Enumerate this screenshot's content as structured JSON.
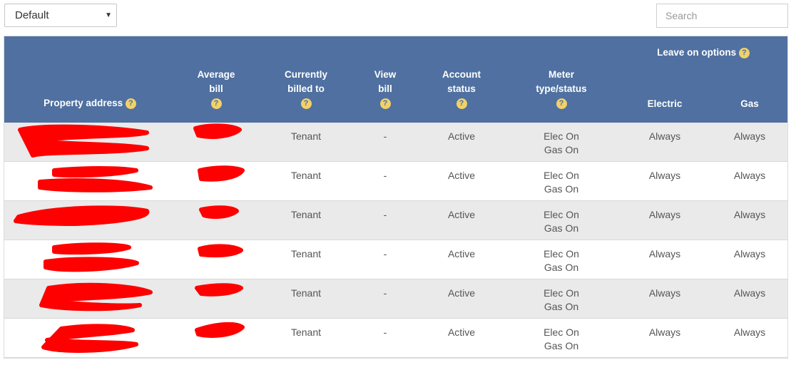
{
  "filter": {
    "selected": "Default",
    "caret": "▼"
  },
  "search": {
    "placeholder": "Search"
  },
  "header": {
    "property_address": "Property address",
    "average_bill_line1": "Average",
    "average_bill_line2": "bill",
    "currently_billed_line1": "Currently",
    "currently_billed_line2": "billed to",
    "view_bill_line1": "View",
    "view_bill_line2": "bill",
    "account_status_line1": "Account",
    "account_status_line2": "status",
    "meter_line1": "Meter",
    "meter_line2": "type/status",
    "leave_on_options": "Leave on options",
    "electric": "Electric",
    "gas": "Gas",
    "help_glyph": "?"
  },
  "rows": [
    {
      "billed_to": "Tenant",
      "view_bill": "-",
      "status": "Active",
      "meter_elec": "Elec On",
      "meter_gas": "Gas On",
      "leave_electric": "Always",
      "leave_gas": "Always"
    },
    {
      "billed_to": "Tenant",
      "view_bill": "-",
      "status": "Active",
      "meter_elec": "Elec On",
      "meter_gas": "Gas On",
      "leave_electric": "Always",
      "leave_gas": "Always"
    },
    {
      "billed_to": "Tenant",
      "view_bill": "-",
      "status": "Active",
      "meter_elec": "Elec On",
      "meter_gas": "Gas On",
      "leave_electric": "Always",
      "leave_gas": "Always"
    },
    {
      "billed_to": "Tenant",
      "view_bill": "-",
      "status": "Active",
      "meter_elec": "Elec On",
      "meter_gas": "Gas On",
      "leave_electric": "Always",
      "leave_gas": "Always"
    },
    {
      "billed_to": "Tenant",
      "view_bill": "-",
      "status": "Active",
      "meter_elec": "Elec On",
      "meter_gas": "Gas On",
      "leave_electric": "Always",
      "leave_gas": "Always"
    },
    {
      "billed_to": "Tenant",
      "view_bill": "-",
      "status": "Active",
      "meter_elec": "Elec On",
      "meter_gas": "Gas On",
      "leave_electric": "Always",
      "leave_gas": "Always"
    }
  ],
  "colors": {
    "header_bg": "#4f70a0",
    "help_icon": "#f1d168",
    "row_alt": "#eaeaea",
    "redaction": "#ff0000"
  }
}
